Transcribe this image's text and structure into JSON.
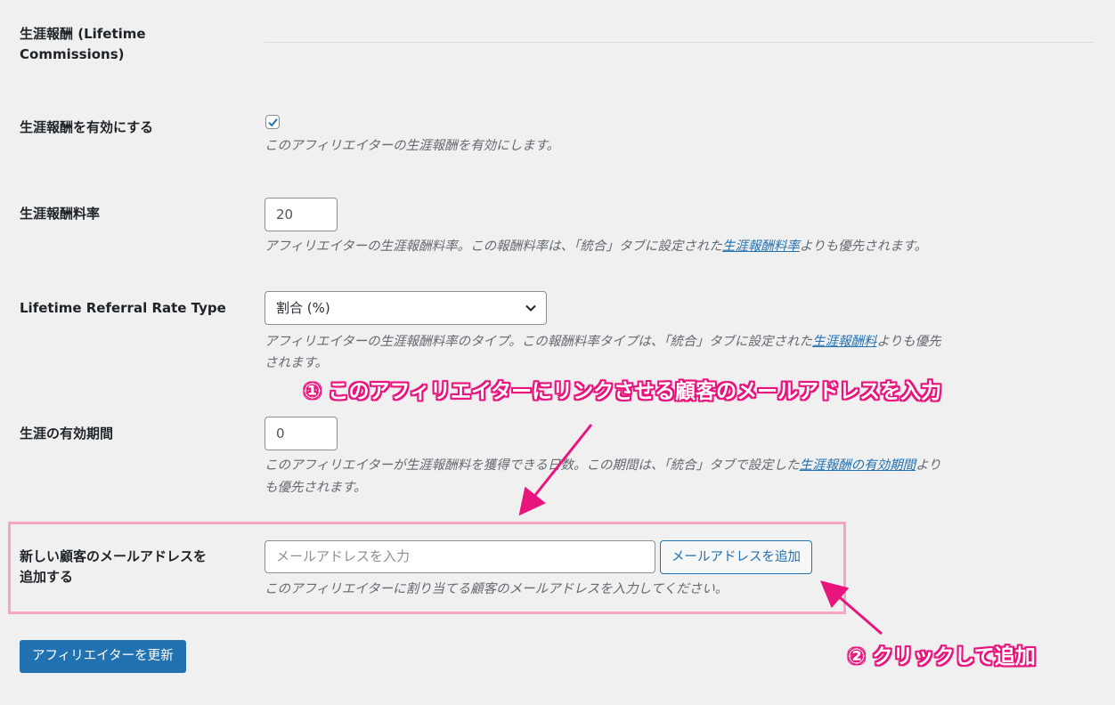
{
  "section": {
    "title": "生涯報酬 (Lifetime Commissions)"
  },
  "enable_lifetime": {
    "label": "生涯報酬を有効にする",
    "checked": true,
    "description": "このアフィリエイターの生涯報酬を有効にします。"
  },
  "rate": {
    "label": "生涯報酬料率",
    "value": "20",
    "desc_before": "アフィリエイターの生涯報酬料率。この報酬料率は、「統合」タブに設定された",
    "desc_link": "生涯報酬料率",
    "desc_after": "よりも優先されます。"
  },
  "rate_type": {
    "label": "Lifetime Referral Rate Type",
    "selected": "割合 (%)",
    "desc_before": "アフィリエイターの生涯報酬料率のタイプ。この報酬料率タイプは、「統合」タブに設定された",
    "desc_link": "生涯報酬料",
    "desc_after": "よりも優先",
    "desc_line2": "されます。"
  },
  "lifetime_period": {
    "label": "生涯の有効期間",
    "value": "0",
    "desc_before": "このアフィリエイターが生涯報酬料を獲得できる日数。この期間は、「統合」タブで設定した",
    "desc_link": "生涯報酬の有効期間",
    "desc_after": "より",
    "desc_line2": "も優先されます。"
  },
  "customer_email": {
    "label_line1": "新しい顧客のメールアドレスを",
    "label_line2": "追加する",
    "placeholder": "メールアドレスを入力",
    "add_button": "メールアドレスを追加",
    "description": "このアフィリエイターに割り当てる顧客のメールアドレスを入力してください。"
  },
  "submit_button": "アフィリエイターを更新",
  "annotations": {
    "step1": "① このアフィリエイターにリンクさせる顧客のメールアドレスを入力",
    "step2": "② クリックして追加",
    "color": "#e8157d"
  },
  "colors": {
    "accent": "#2271b1",
    "highlight_border": "#f4a6c4",
    "background": "#f0f0f1"
  }
}
